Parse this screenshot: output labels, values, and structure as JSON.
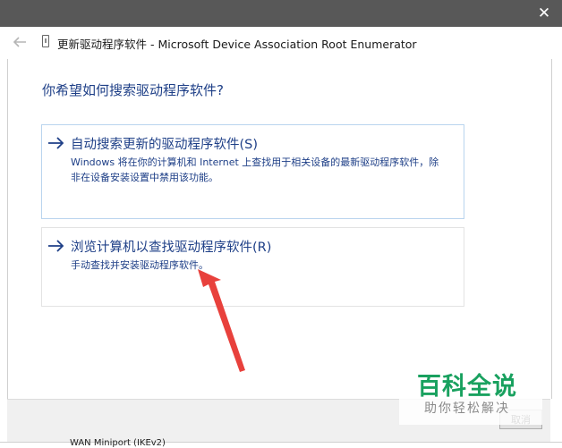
{
  "window": {
    "title": "更新驱动程序软件 - Microsoft Device Association Root Enumerator",
    "close_glyph": "✕"
  },
  "main": {
    "question": "你希望如何搜索驱动程序软件?",
    "options": [
      {
        "title": "自动搜索更新的驱动程序软件(S)",
        "description": "Windows 将在你的计算机和 Internet 上查找用于相关设备的最新驱动程序软件，除非在设备安装设置中禁用该功能。",
        "icon": "arrow-right-icon"
      },
      {
        "title": "浏览计算机以查找驱动程序软件(R)",
        "description": "手动查找并安装驱动程序软件。",
        "icon": "arrow-right-icon"
      }
    ]
  },
  "footer": {
    "cancel_label": "取消"
  },
  "background": {
    "device_item": "WAN Miniport (IKEv2)"
  },
  "watermark": {
    "brand": "百科全说",
    "subtitle": "助你轻松解决"
  },
  "colors": {
    "titlebar": "#585858",
    "link_blue": "#1e3f87",
    "selected_border": "#b9d4ee",
    "annotation_red": "#e8413c",
    "watermark_green": "#19a15f"
  }
}
